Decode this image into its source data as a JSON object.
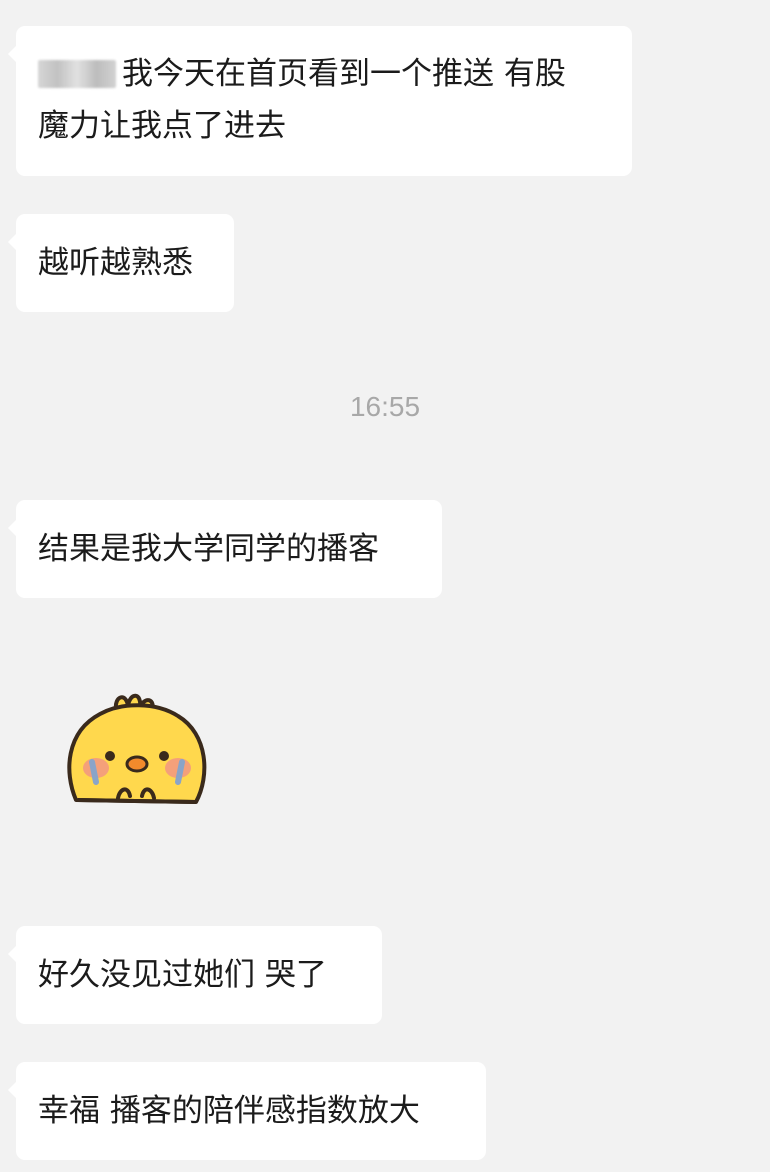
{
  "messages": [
    {
      "text_line1": "我今天在首页看到一个推送 有股",
      "text_line2": "魔力让我点了进去"
    },
    {
      "text": "越听越熟悉"
    },
    {
      "text": "结果是我大学同学的播客"
    },
    {
      "text": "好久没见过她们 哭了"
    },
    {
      "text": "幸福 播客的陪伴感指数放大"
    }
  ],
  "timestamp": "16:55",
  "sticker": {
    "icon": "crying-chick-sticker"
  },
  "colors": {
    "background": "#f2f2f2",
    "bubble": "#ffffff",
    "text": "#1b1b1b",
    "timestamp": "#a8a8a8",
    "chick_yellow": "#ffd84d"
  }
}
